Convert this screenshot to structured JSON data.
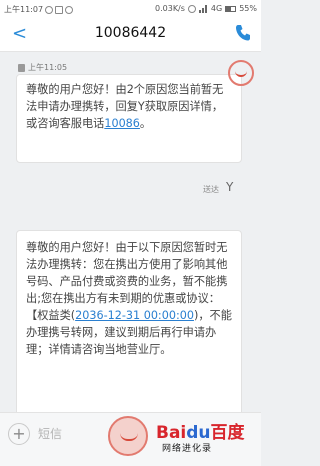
{
  "status_bar": {
    "time": "上午11:07",
    "speed": "0.03K/s",
    "network": "4G",
    "battery": "55%"
  },
  "header": {
    "back": "<",
    "title": "10086442"
  },
  "thread": {
    "timestamp": "上午11:05",
    "message_1": {
      "text": "尊敬的用户您好！由2个原因您当前暂无法申请办理携转，回复Y获取原因详情，或咨询客服电话",
      "link": "10086",
      "tail": "。"
    },
    "delivered_label": "送达",
    "reply": "Y",
    "message_2": {
      "line_1": "尊敬的用户您好！由于以下原因您暂时无法办理携转：您在携出方使用了影响其他号码、产品付费或资费的业务，暂不能携出;您在携出方有未到期的优惠或协议：【权益类(",
      "date": "2036-12-31 00:00:00",
      "line_2": ")，不能办理携号转网，建议到期后再行申请办理；详情请咨询当地营业厅。"
    }
  },
  "input": {
    "placeholder": "短信"
  },
  "watermark": {
    "brand_red": "Bai",
    "brand_blue": "du",
    "brand_cn": "百度",
    "sub": "网络进化录"
  },
  "colors": {
    "accent": "#2a8bd8",
    "link": "#2a7fd0",
    "stamp": "#e27a6f"
  }
}
